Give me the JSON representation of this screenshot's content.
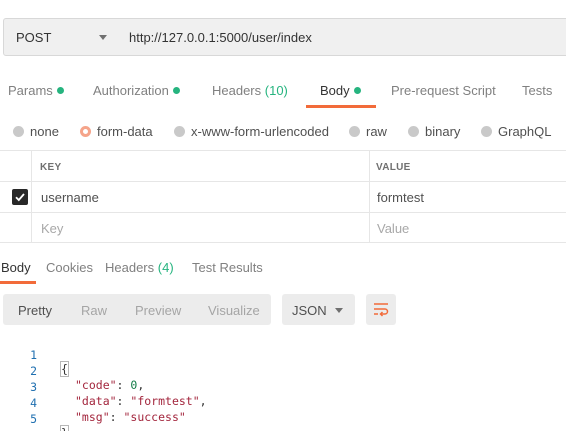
{
  "request": {
    "method": "POST",
    "url": "http://127.0.0.1:5000/user/index"
  },
  "request_tabs": [
    {
      "label": "Params",
      "dot": true
    },
    {
      "label": "Authorization",
      "dot": true
    },
    {
      "label": "Headers",
      "count": "(10)"
    },
    {
      "label": "Body",
      "dot": true,
      "active": true
    },
    {
      "label": "Pre-request Script"
    },
    {
      "label": "Tests"
    }
  ],
  "body_types": [
    {
      "label": "none",
      "selected": false
    },
    {
      "label": "form-data",
      "selected": true
    },
    {
      "label": "x-www-form-urlencoded",
      "selected": false
    },
    {
      "label": "raw",
      "selected": false
    },
    {
      "label": "binary",
      "selected": false
    },
    {
      "label": "GraphQL",
      "selected": false
    }
  ],
  "table": {
    "headers": {
      "key": "KEY",
      "value": "VALUE"
    },
    "rows": [
      {
        "checked": true,
        "key": "username",
        "value": "formtest"
      }
    ],
    "placeholder": {
      "key": "Key",
      "value": "Value"
    }
  },
  "response_tabs": [
    {
      "label": "Body",
      "active": true
    },
    {
      "label": "Cookies"
    },
    {
      "label": "Headers",
      "count": "(4)"
    },
    {
      "label": "Test Results"
    }
  ],
  "view_modes": [
    "Pretty",
    "Raw",
    "Preview",
    "Visualize"
  ],
  "active_view": "Pretty",
  "format": "JSON",
  "response_body": {
    "line_numbers": [
      "1",
      "2",
      "3",
      "4",
      "5"
    ],
    "open_brace": "{",
    "close_brace": "}",
    "entries": [
      {
        "key": "\"code\"",
        "sep": ": ",
        "value": "0",
        "kind": "number",
        "trail": ","
      },
      {
        "key": "\"data\"",
        "sep": ": ",
        "value": "\"formtest\"",
        "kind": "string",
        "trail": ","
      },
      {
        "key": "\"msg\"",
        "sep": ": ",
        "value": "\"success\"",
        "kind": "string",
        "trail": ""
      }
    ]
  },
  "colors": {
    "accent": "#f26b3a",
    "status_dot": "#26b47f",
    "line_number": "#1f6fb0",
    "json_string": "#a3263d",
    "json_number": "#107a45"
  },
  "icons": {
    "method_dropdown": "chevron-down-icon",
    "checkbox": "checkmark-icon",
    "wrap": "wrap-lines-icon",
    "format_dropdown": "chevron-down-icon"
  }
}
